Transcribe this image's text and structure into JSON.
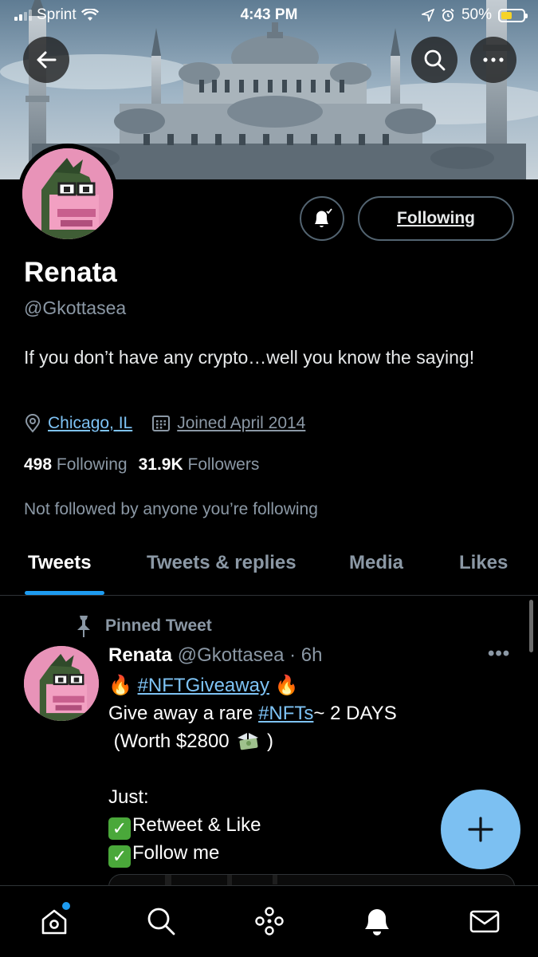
{
  "status_bar": {
    "carrier": "Sprint",
    "time": "4:43 PM",
    "battery": "50%",
    "battery_level": 0.5
  },
  "profile": {
    "name": "Renata",
    "handle": "@Gkottasea",
    "bio": "If you don’t have any crypto…well you know the saying!",
    "location": "Chicago, IL",
    "joined": "Joined April 2014",
    "following_count": "498",
    "following_label": "Following",
    "followers_count": "31.9K",
    "followers_label": "Followers",
    "not_followed": "Not followed by anyone you’re following",
    "follow_button": "Following"
  },
  "tabs": [
    {
      "label": "Tweets",
      "active": true
    },
    {
      "label": "Tweets & replies",
      "active": false
    },
    {
      "label": "Media",
      "active": false
    },
    {
      "label": "Likes",
      "active": false
    }
  ],
  "pinned_tweet": {
    "pinned_label": "Pinned Tweet",
    "author_name": "Renata",
    "author_handle": "@Gkottasea",
    "time": "· 6h",
    "hashtag_giveaway": "#NFTGiveaway",
    "line2_prefix": "Give away a rare ",
    "hashtag_nfts": "#NFTs",
    "line2_suffix": "~ 2 DAYS",
    "line3_text": " (Worth $2800 ",
    "line3_end": ")",
    "line_just": "Just:",
    "task1": "Retweet & Like",
    "task2": "Follow me",
    "more": "•••"
  },
  "icons": {
    "back": "arrow-left-icon",
    "search": "search-icon",
    "more": "more-icon",
    "bell": "notification-bell-icon",
    "location": "location-pin-icon",
    "calendar": "calendar-icon",
    "pin": "pin-icon",
    "compose": "plus-icon",
    "home": "home-icon",
    "explore": "search-icon",
    "spaces": "spaces-icon",
    "notifications": "bell-icon",
    "messages": "mail-icon"
  },
  "colors": {
    "background": "#000000",
    "accent": "#1d9bf0",
    "link": "#7ec3f5",
    "secondary_text": "#8b98a5",
    "fab": "#7cc0f2",
    "avatar_pink": "#e893b8"
  }
}
